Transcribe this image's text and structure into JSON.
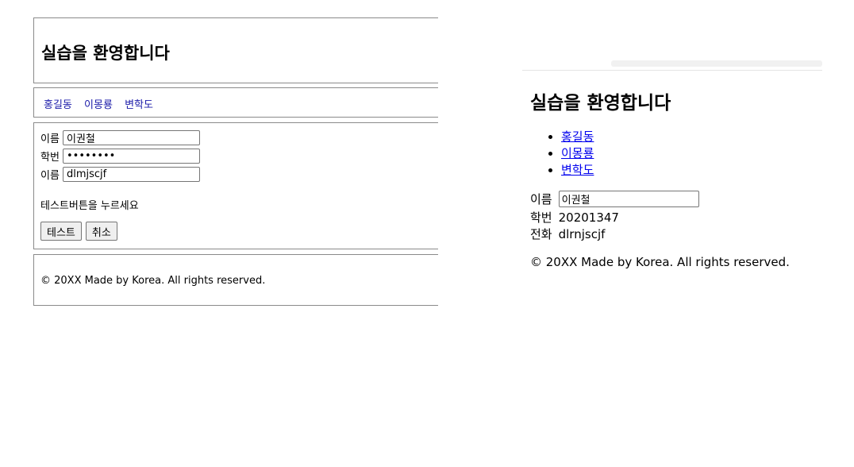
{
  "left": {
    "header_title": "실습을 환영합니다",
    "nav": [
      "홍길동",
      "이몽룡",
      "변학도"
    ],
    "form": {
      "name_label": "이름",
      "name_value": "이권철",
      "id_label": "학번",
      "id_value": "20201347",
      "name2_label": "이름",
      "name2_value": "dlmjscjf"
    },
    "instruction": "테스트버튼을 누르세요",
    "test_button": "테스트",
    "cancel_button": "취소",
    "footer": "© 20XX Made by Korea. All rights reserved."
  },
  "right": {
    "title": "실습을 환영합니다",
    "links": [
      "홍길동",
      "이몽룡",
      "변학도"
    ],
    "name_label": "이름",
    "name_value": "이권철",
    "id_label": "학번",
    "id_value": "20201347",
    "phone_label": "전화",
    "phone_value": "dlrnjscjf",
    "footer": "© 20XX Made by Korea. All rights reserved."
  }
}
